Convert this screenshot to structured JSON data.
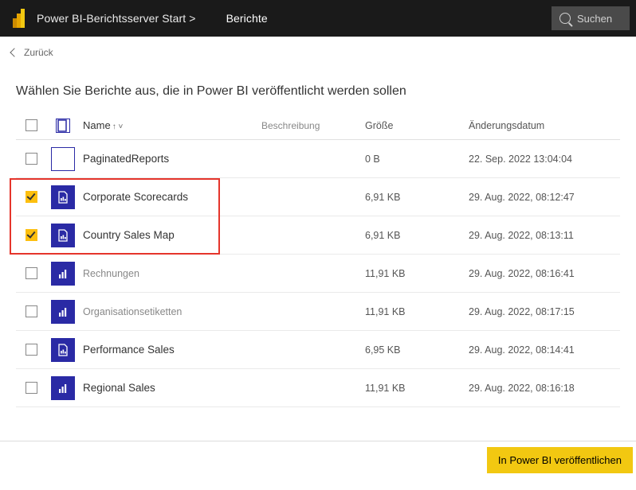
{
  "topbar": {
    "breadcrumb_home": "Power BI-Berichtsserver Start >",
    "breadcrumb_current": "Berichte",
    "search_placeholder": "Suchen"
  },
  "back_label": "Zurück",
  "page_title": "Wählen Sie Berichte aus, die in Power BI veröffentlicht werden sollen",
  "columns": {
    "name": "Name",
    "name_sort": "↑ ˅",
    "description": "Beschreibung",
    "size": "Größe",
    "modified": "Änderungsdatum"
  },
  "rows": [
    {
      "checked": false,
      "icon": "folder",
      "muted": false,
      "name": "PaginatedReports",
      "desc": "",
      "size": "0 B",
      "date": "22. Sep. 2022 13:04:04"
    },
    {
      "checked": true,
      "icon": "report",
      "muted": false,
      "name": "Corporate Scorecards",
      "desc": "",
      "size": "6,91 KB",
      "date": "29. Aug. 2022, 08:12:47"
    },
    {
      "checked": true,
      "icon": "report",
      "muted": false,
      "name": "Country Sales Map",
      "desc": "",
      "size": "6,91 KB",
      "date": "29. Aug. 2022, 08:13:11"
    },
    {
      "checked": false,
      "icon": "chart",
      "muted": true,
      "name": "Rechnungen",
      "desc": "",
      "size": "11,91 KB",
      "date": "29. Aug. 2022, 08:16:41"
    },
    {
      "checked": false,
      "icon": "chart",
      "muted": true,
      "name": "Organisationsetiketten",
      "desc": "",
      "size": "11,91 KB",
      "date": "29. Aug. 2022, 08:17:15"
    },
    {
      "checked": false,
      "icon": "report",
      "muted": false,
      "name": "Performance Sales",
      "desc": "",
      "size": "6,95 KB",
      "date": "29. Aug. 2022, 08:14:41"
    },
    {
      "checked": false,
      "icon": "chart",
      "muted": false,
      "name": "Regional Sales",
      "desc": "",
      "size": "11,91 KB",
      "date": "29. Aug. 2022, 08:16:18"
    }
  ],
  "footer": {
    "publish": "In Power BI veröffentlichen"
  },
  "highlight": {
    "top_row": 1,
    "row_span": 2
  }
}
